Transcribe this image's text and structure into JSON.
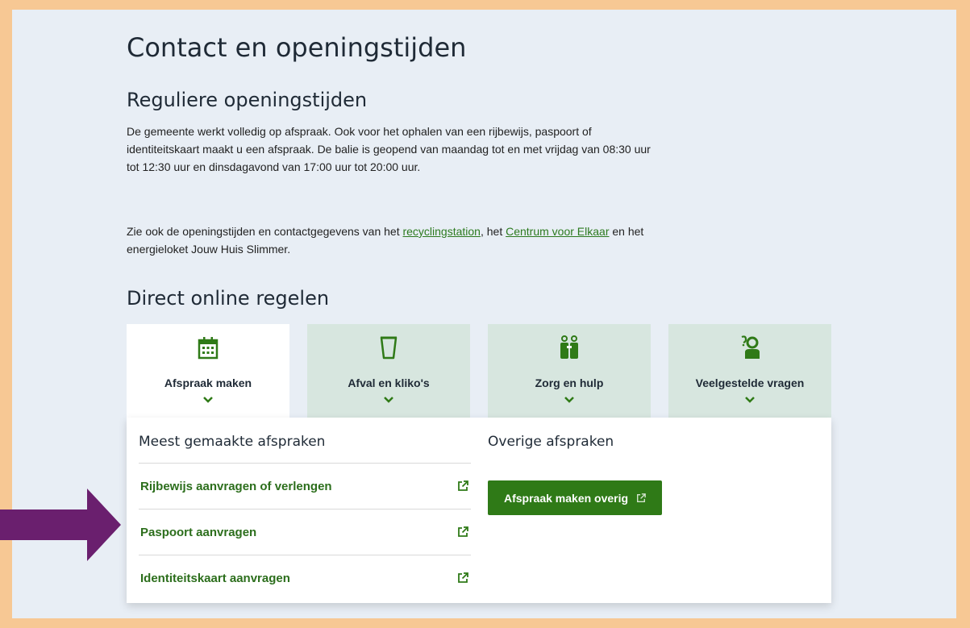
{
  "page": {
    "title": "Contact en openingstijden"
  },
  "regular": {
    "heading": "Reguliere openingstijden",
    "paragraph1": "De gemeente werkt volledig op afspraak. Ook voor het ophalen van een rijbewijs, paspoort of identiteitskaart maakt u een afspraak. De balie is geopend van maandag tot en met vrijdag van 08:30 uur tot 12:30 uur en dinsdagavond van 17:00 uur tot 20:00 uur.",
    "p2_prefix": "Zie ook de openingstijden en contactgegevens van het ",
    "p2_link1": "recyclingstation",
    "p2_mid": ", het ",
    "p2_link2": "Centrum voor Elkaar",
    "p2_suffix": " en het energieloket Jouw Huis Slimmer."
  },
  "direct": {
    "heading": "Direct online regelen",
    "tabs": [
      {
        "label": "Afspraak maken",
        "icon": "calendar-icon",
        "active": true
      },
      {
        "label": "Afval en kliko's",
        "icon": "waste-bin-icon",
        "active": false
      },
      {
        "label": "Zorg en hulp",
        "icon": "people-care-icon",
        "active": false
      },
      {
        "label": "Veelgestelde vragen",
        "icon": "question-person-icon",
        "active": false
      }
    ]
  },
  "panel": {
    "left_heading": "Meest gemaakte afspraken",
    "items": [
      {
        "label": "Rijbewijs aanvragen of verlengen",
        "icon": "external-link-icon"
      },
      {
        "label": "Paspoort aanvragen",
        "icon": "external-link-icon"
      },
      {
        "label": "Identiteitskaart aanvragen",
        "icon": "external-link-icon"
      }
    ],
    "right_heading": "Overige afspraken",
    "button_label": "Afspraak maken overig"
  },
  "colors": {
    "accent_green": "#2f7a17",
    "link_green": "#2c7a1f",
    "tab_bg": "#d7e6df",
    "page_bg": "#e8eef5",
    "frame": "#f7c894",
    "annotation_arrow": "#6a1f6e"
  }
}
